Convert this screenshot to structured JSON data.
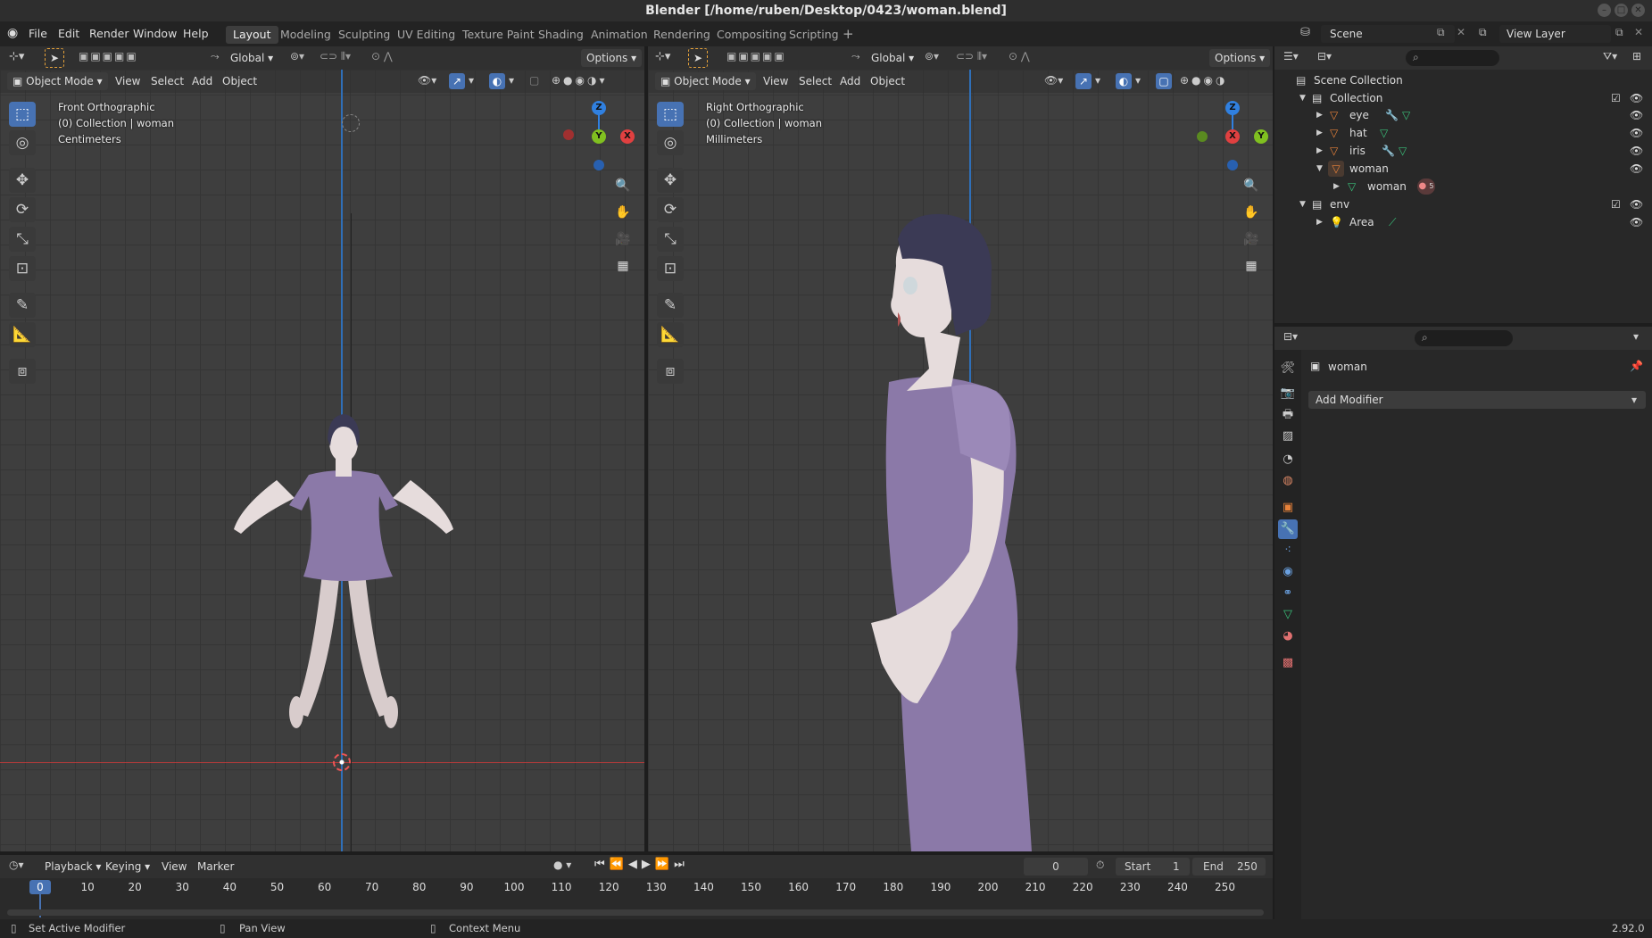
{
  "title": "Blender [/home/ruben/Desktop/0423/woman.blend]",
  "menu": [
    "File",
    "Edit",
    "Render",
    "Window",
    "Help"
  ],
  "workspaces": [
    "Layout",
    "Modeling",
    "Sculpting",
    "UV Editing",
    "Texture Paint",
    "Shading",
    "Animation",
    "Rendering",
    "Compositing",
    "Scripting"
  ],
  "active_workspace": "Layout",
  "scene": "Scene",
  "view_layer": "View Layer",
  "left_view": {
    "orientation": "Global",
    "options": "Options",
    "mode": "Object Mode",
    "menus": [
      "View",
      "Select",
      "Add",
      "Object"
    ],
    "overlay_lines": [
      "Front Orthographic",
      "(0) Collection | woman",
      "Centimeters"
    ],
    "gizmo": {
      "z": "Z",
      "y": "Y",
      "x": "X"
    }
  },
  "right_view": {
    "orientation": "Global",
    "options": "Options",
    "mode": "Object Mode",
    "menus": [
      "View",
      "Select",
      "Add",
      "Object"
    ],
    "overlay_lines": [
      "Right Orthographic",
      "(0) Collection | woman",
      "Millimeters"
    ],
    "gizmo": {
      "z": "Z",
      "y": "Y",
      "x": "X"
    }
  },
  "outliner": {
    "scene_collection": "Scene Collection",
    "collection": "Collection",
    "items": [
      "eye",
      "hat",
      "iris",
      "woman"
    ],
    "mesh": "woman",
    "env": "env",
    "area": "Area",
    "badge": "5"
  },
  "properties": {
    "object": "woman",
    "add_modifier": "Add Modifier"
  },
  "timeline": {
    "menus": [
      "Playback",
      "Keying",
      "View",
      "Marker"
    ],
    "current_frame": "0",
    "start_label": "Start",
    "start": "1",
    "end_label": "End",
    "end": "250",
    "ticks": [
      "0",
      "10",
      "20",
      "30",
      "40",
      "50",
      "60",
      "70",
      "80",
      "90",
      "100",
      "110",
      "120",
      "130",
      "140",
      "150",
      "160",
      "170",
      "180",
      "190",
      "200",
      "210",
      "220",
      "230",
      "240",
      "250"
    ]
  },
  "status": {
    "left": "Set Active Modifier",
    "middle": "Pan View",
    "right": "Context Menu",
    "version": "2.92.0"
  },
  "colors": {
    "accent": "#4772b3",
    "dress": "#8b79a8",
    "skin": "#e6dcdc",
    "hair": "#3b3a55",
    "x_axis": "#e04040",
    "y_axis": "#80c020",
    "z_axis": "#3080e0"
  }
}
